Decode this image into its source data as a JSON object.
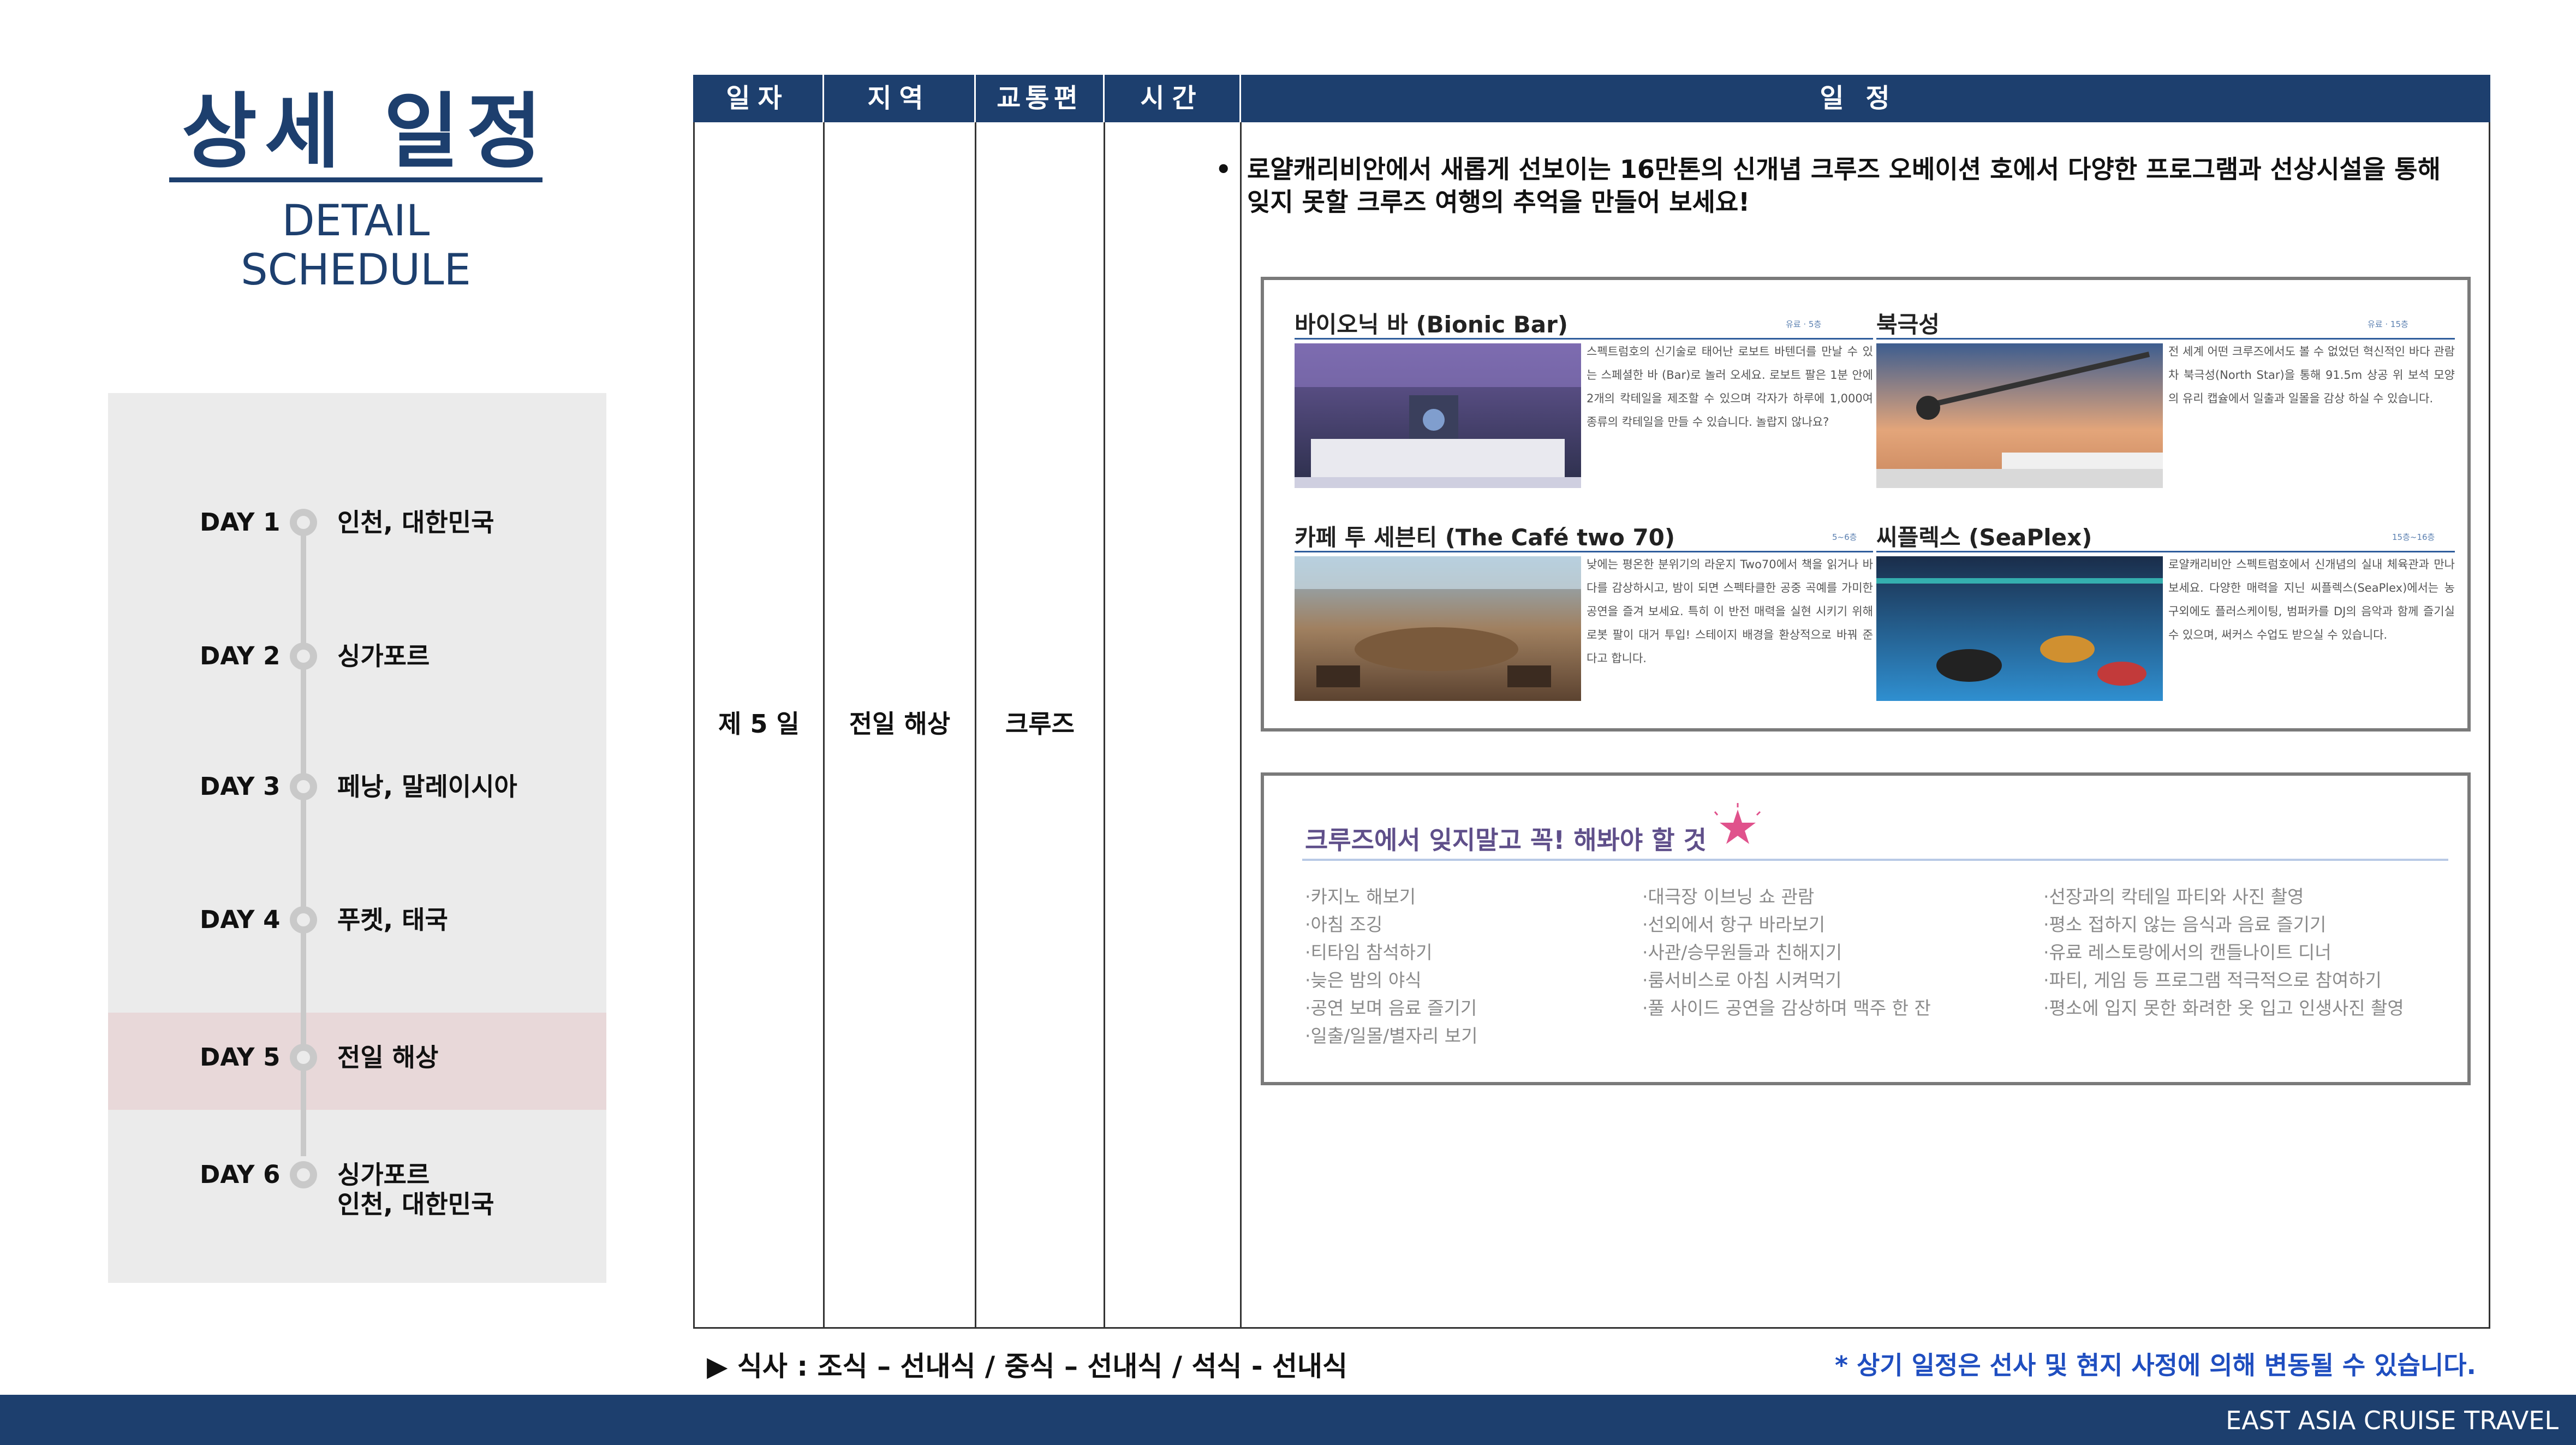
{
  "title": {
    "ko": "상세 일정",
    "en": "DETAIL SCHEDULE"
  },
  "days": [
    {
      "label": "DAY 1",
      "place": "인천, 대한민국"
    },
    {
      "label": "DAY 2",
      "place": "싱가포르"
    },
    {
      "label": "DAY 3",
      "place": "페낭, 말레이시아"
    },
    {
      "label": "DAY 4",
      "place": "푸켓, 태국"
    },
    {
      "label": "DAY 5",
      "place": "전일 해상",
      "active": true
    },
    {
      "label": "DAY 6",
      "place": "싱가포르",
      "place2": "인천, 대한민국"
    }
  ],
  "table": {
    "headers": [
      "일자",
      "지역",
      "교통편",
      "시간",
      "일정"
    ],
    "row": {
      "day": "제 5 일",
      "region": "전일 해상",
      "transport": "크루즈",
      "time": ""
    },
    "intro_bullet": "•",
    "intro": "로얄캐리비안에서 새롭게 선보이는 16만톤의 신개념 크루즈 오베이션 호에서 다양한 프로그램과 선상시설을 통해 잊지 못할 크루즈 여행의 추억을 만들어 보세요!"
  },
  "amenities": [
    {
      "title": "바이오닉 바 (Bionic Bar)",
      "meta": "유료 · 5층",
      "description": "스펙트럼호의 신기술로 태어난 로보트 바텐더를 만날 수 있는 스페셜한 바 (Bar)로 놀러 오세요. 로보트 팔은 1분 안에 2개의 칵테일을 제조할 수 있으며 각자가 하루에 1,000여 종류의 칵테일을 만들 수 있습니다. 놀랍지 않나요?"
    },
    {
      "title": "북극성",
      "meta": "유료 · 15층",
      "description": "전 세계 어떤 크루즈에서도 볼 수 없었던 혁신적인 바다 관람차 북극성(North Star)을 통해 91.5m 상공 위 보석 모양의 유리 캡슐에서 일출과 일몰을 감상 하실 수 있습니다."
    },
    {
      "title": "카페 투 세븐티 (The Café two 70)",
      "meta": "5~6층",
      "description": "낮에는 평온한 분위기의 라운지 Two70에서 책을 읽거나 바다를 감상하시고, 밤이 되면 스펙타클한 공중 곡예를 가미한 공연을 즐겨 보세요. 특히 이 반전 매력을 실현 시키기 위해 로봇 팔이 대거 투입! 스테이지 배경을 환상적으로 바꿔 준다고 합니다."
    },
    {
      "title": "씨플렉스 (SeaPlex)",
      "meta": "15층~16층",
      "description": "로얄캐리비안 스펙트럼호에서 신개념의 실내 체육관과 만나보세요. 다양한 매력을 지닌 씨플렉스(SeaPlex)에서는 농구외에도 플러스케이팅, 범퍼카를 DJ의 음악과 함께 즐기실 수 있으며, 써커스 수업도 받으실 수 있습니다."
    }
  ],
  "mustdo": {
    "title": "크루즈에서 잊지말고 꼭! 해봐야 할 것",
    "columns": [
      [
        "·카지노 해보기",
        "·아침 조깅",
        "·티타임 참석하기",
        "·늦은 밤의 야식",
        "·공연 보며 음료 즐기기",
        "·일출/일몰/별자리 보기"
      ],
      [
        "·대극장 이브닝 쇼 관람",
        "·선외에서 항구 바라보기",
        "·사관/승무원들과 친해지기",
        "·룸서비스로 아침 시켜먹기",
        "·풀 사이드 공연을 감상하며 맥주 한 잔"
      ],
      [
        "·선장과의 칵테일 파티와 사진 촬영",
        "·평소 접하지 않는 음식과 음료 즐기기",
        "·유료 레스토랑에서의 캔들나이트 디너",
        "·파티, 게임 등 프로그램 적극적으로 참여하기",
        "·평소에 입지 못한 화려한 옷 입고 인생사진 촬영"
      ]
    ]
  },
  "footer": {
    "meal": "▶ 식사 : 조식 – 선내식 / 중식 – 선내식 / 석식 - 선내식",
    "notice": "* 상기 일정은 선사 및 현지 사정에 의해 변동될 수 있습니다.",
    "brand": "EAST ASIA CRUISE TRAVEL"
  },
  "colors": {
    "navy": "#1d3f6e",
    "highlight": "#e8d8d9",
    "panel": "#ebebeb",
    "notice": "#1f4ec0"
  }
}
